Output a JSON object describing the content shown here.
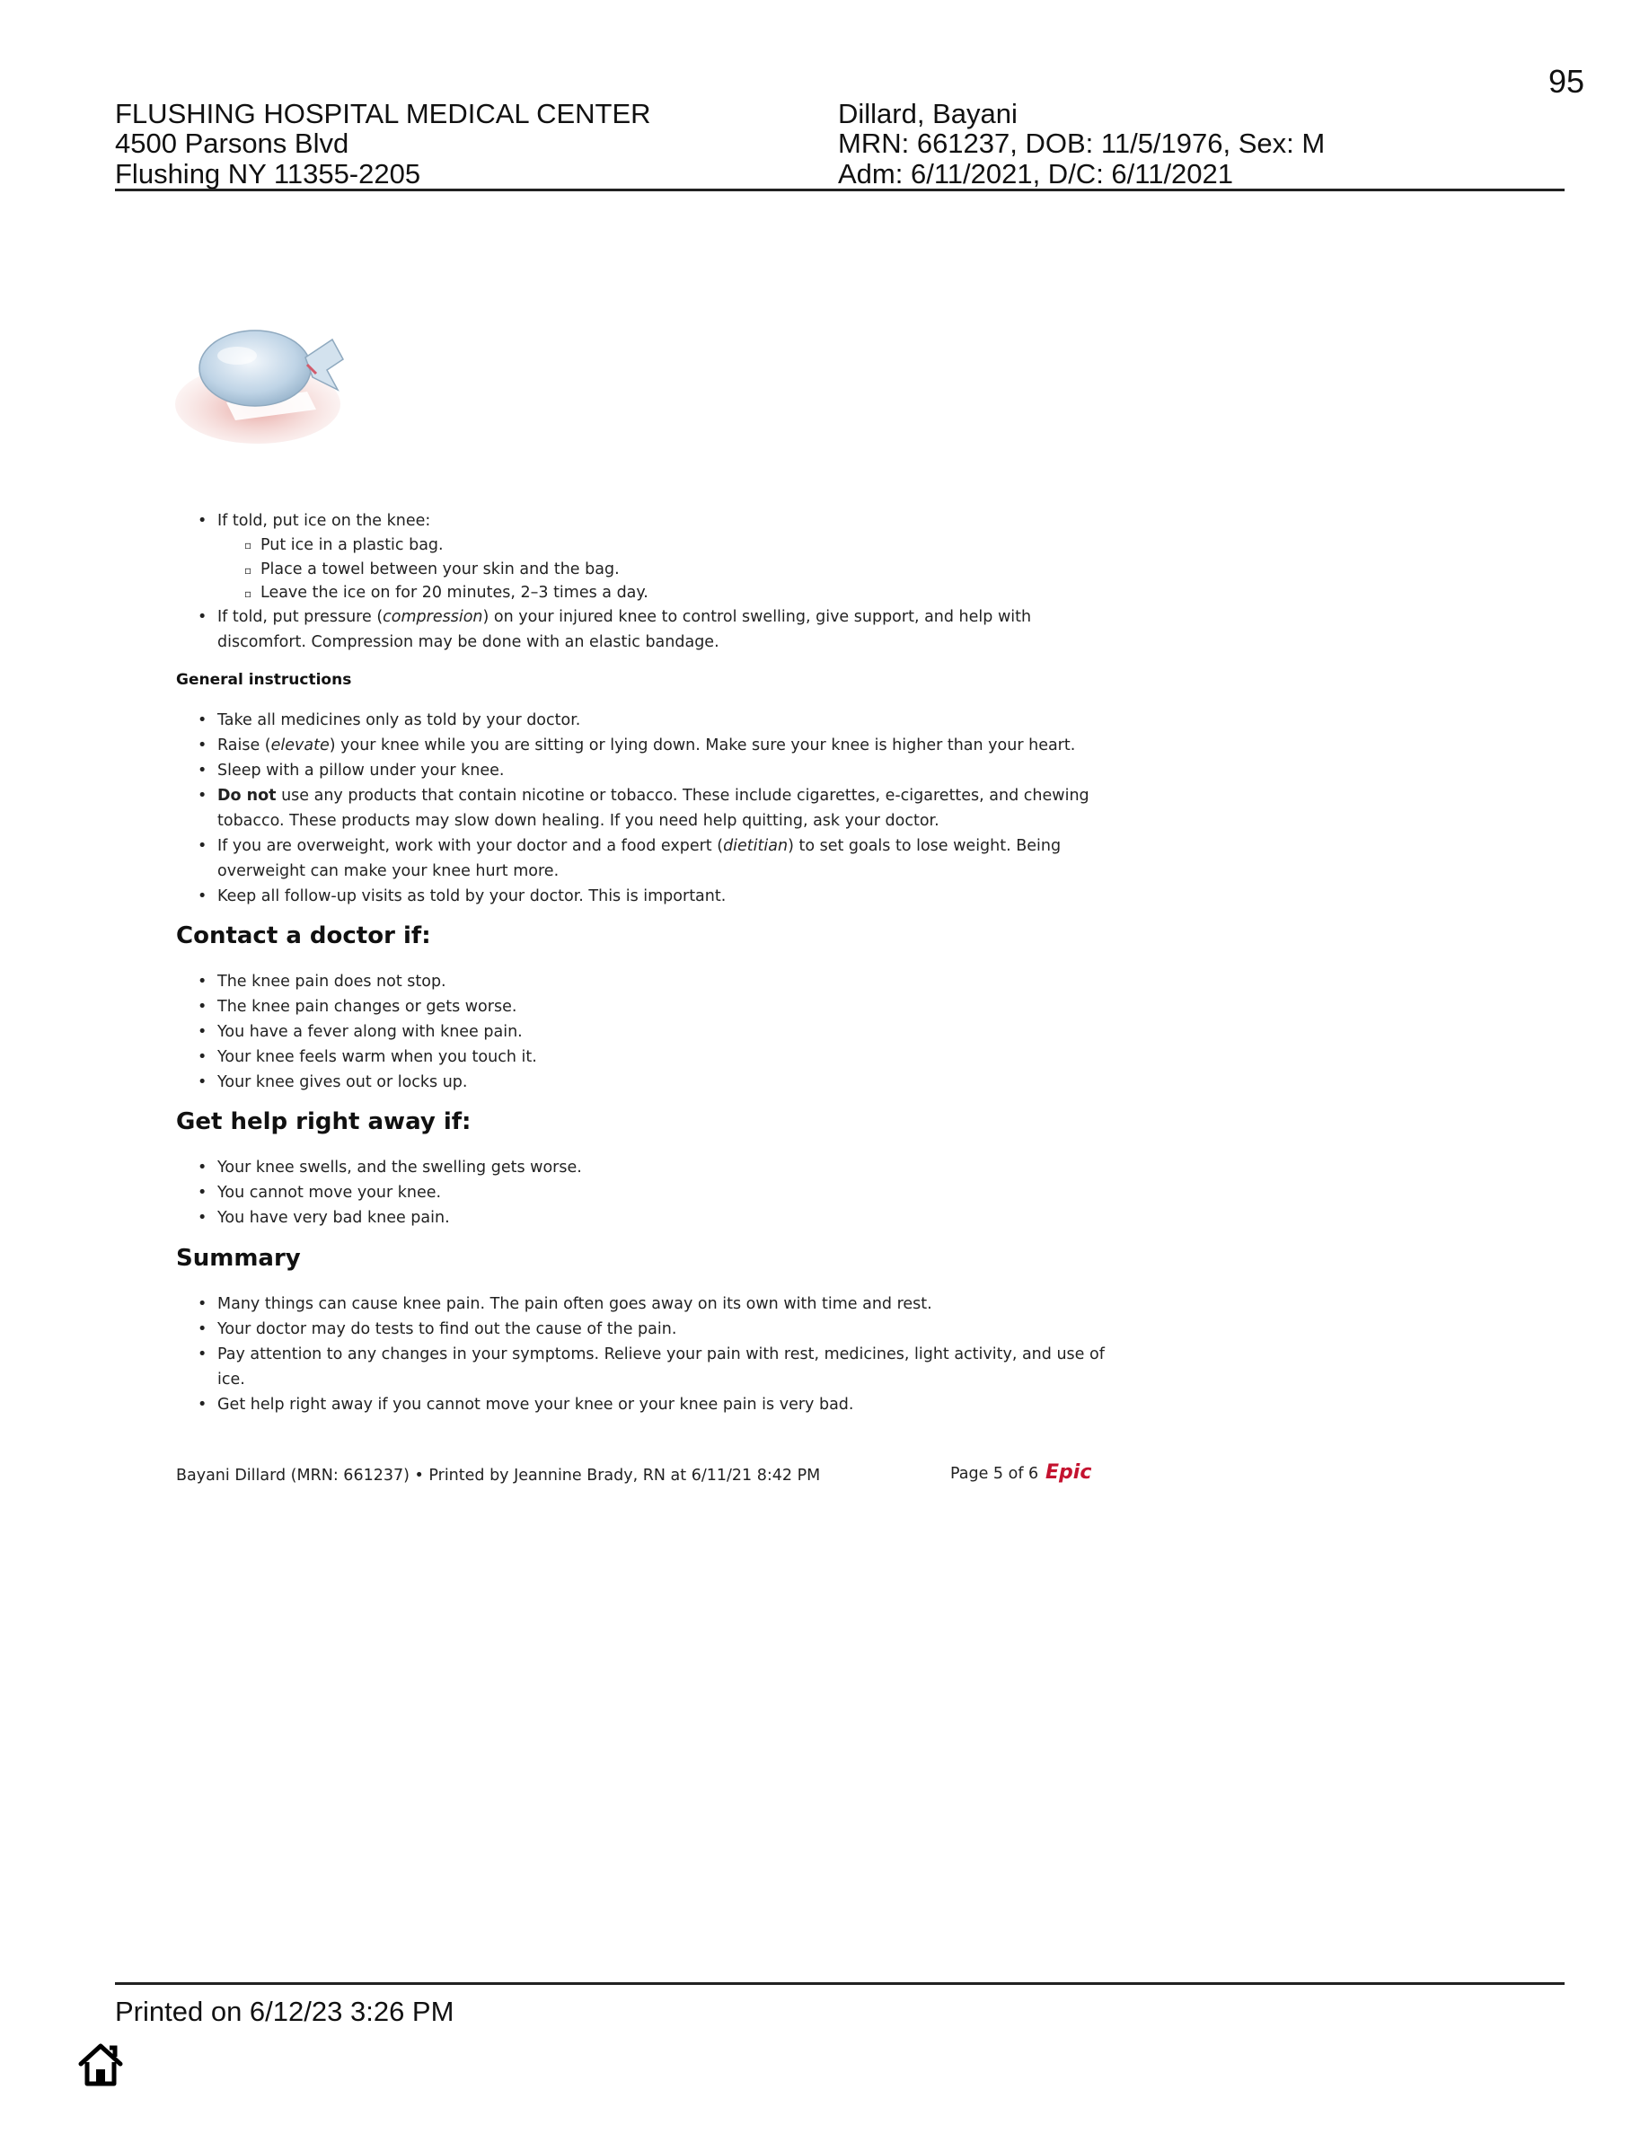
{
  "page_number": "95",
  "header": {
    "hospital_name": "FLUSHING HOSPITAL MEDICAL CENTER",
    "address_line1": "4500 Parsons Blvd",
    "address_line2": "Flushing NY 11355-2205",
    "patient_name": "Dillard, Bayani",
    "patient_ids": "MRN: 661237, DOB: 11/5/1976, Sex: M",
    "admission": "Adm: 6/11/2021, D/C: 6/11/2021"
  },
  "ice_section": {
    "item1": "If told, put ice on the knee:",
    "sub1": "Put ice in a plastic bag.",
    "sub2": "Place a towel between your skin and the bag.",
    "sub3": "Leave the ice on for 20 minutes, 2–3 times a day.",
    "item2_pre": "If told, put pressure (",
    "item2_em": "compression",
    "item2_post": ") on your injured knee to control swelling, give support, and help with",
    "item2_cont": "discomfort. Compression may be done with an elastic bandage."
  },
  "general": {
    "heading": "General instructions",
    "i1": "Take all medicines only as told by your doctor.",
    "i2_pre": "Raise (",
    "i2_em": "elevate",
    "i2_post": ") your knee while you are sitting or lying down. Make sure your knee is higher than your heart.",
    "i3": "Sleep with a pillow under your knee.",
    "i4_bold": "Do not",
    "i4_rest": " use any products that contain nicotine or tobacco. These include cigarettes, e-cigarettes, and chewing",
    "i4_cont": "tobacco. These products may slow down healing. If you need help quitting, ask your doctor.",
    "i5_pre": "If you are overweight, work with your doctor and a food expert (",
    "i5_em": "dietitian",
    "i5_post": ") to set goals to lose weight. Being",
    "i5_cont": "overweight can make your knee hurt more.",
    "i6": "Keep all follow-up visits as told by your doctor. This is important."
  },
  "contact": {
    "heading": "Contact a doctor if:",
    "items": [
      "The knee pain does not stop.",
      "The knee pain changes or gets worse.",
      "You have a fever along with knee pain.",
      "Your knee feels warm when you touch it.",
      "Your knee gives out or locks up."
    ]
  },
  "help": {
    "heading": "Get help right away if:",
    "items": [
      "Your knee swells, and the swelling gets worse.",
      "You cannot move your knee.",
      "You have very bad knee pain."
    ]
  },
  "summary": {
    "heading": "Summary",
    "i1": "Many things can cause knee pain. The pain often goes away on its own with time and rest.",
    "i2": "Your doctor may do tests to find out the cause of the pain.",
    "i3": "Pay attention to any changes in your symptoms. Relieve your pain with rest, medicines, light activity, and use of",
    "i3_cont": "ice.",
    "i4": "Get help right away if you cannot move your knee or your knee pain is very bad."
  },
  "inner_footer": {
    "printed_by": "Bayani Dillard (MRN: 661237) • Printed by Jeannine Brady, RN at 6/11/21  8:42 PM",
    "page_of": "Page 5 of 6",
    "logo_text": "Epic"
  },
  "outer_footer": {
    "printed_on": "Printed on 6/12/23  3:26 PM"
  },
  "icons": {
    "home": "home-icon",
    "ice": "ice-bag-on-knee-illustration"
  }
}
